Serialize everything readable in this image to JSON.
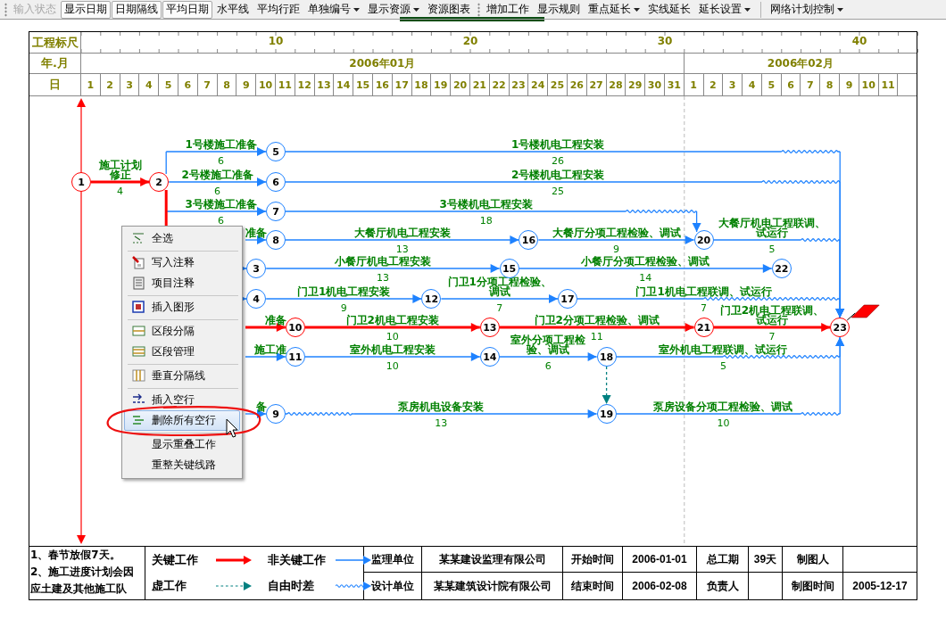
{
  "toolbar": {
    "groups": [
      {
        "kind": "grip",
        "items": [
          {
            "label": "输入状态",
            "disabled": true,
            "pressed": false,
            "dropdown": false
          },
          {
            "label": "显示日期",
            "disabled": false,
            "pressed": true,
            "dropdown": false
          },
          {
            "label": "日期隔线",
            "disabled": false,
            "pressed": true,
            "dropdown": false
          },
          {
            "label": "平均日期",
            "disabled": false,
            "pressed": true,
            "dropdown": false
          },
          {
            "label": "水平线",
            "disabled": false,
            "pressed": false,
            "dropdown": false
          },
          {
            "label": "平均行距",
            "disabled": false,
            "pressed": false,
            "dropdown": false
          },
          {
            "label": "单独编号",
            "disabled": false,
            "pressed": false,
            "dropdown": true
          },
          {
            "label": "显示资源",
            "disabled": false,
            "pressed": false,
            "dropdown": true
          },
          {
            "label": "资源图表",
            "disabled": false,
            "pressed": false,
            "dropdown": false
          }
        ]
      },
      {
        "kind": "grip",
        "items": [
          {
            "label": "增加工作",
            "disabled": false,
            "pressed": false,
            "dropdown": false
          },
          {
            "label": "显示规则",
            "disabled": false,
            "pressed": false,
            "dropdown": false
          },
          {
            "label": "重点延长",
            "disabled": false,
            "pressed": false,
            "dropdown": true
          },
          {
            "label": "实线延长",
            "disabled": false,
            "pressed": false,
            "dropdown": false
          },
          {
            "label": "延长设置",
            "disabled": false,
            "pressed": false,
            "dropdown": true
          }
        ]
      },
      {
        "kind": "line",
        "items": [
          {
            "label": "网络计划控制",
            "disabled": false,
            "pressed": false,
            "dropdown": true
          }
        ]
      }
    ]
  },
  "header": {
    "scale_title": "工程标尺",
    "scale_labels": [
      "10",
      "20",
      "30",
      "40"
    ],
    "month_title": "年.月",
    "day_title": "日",
    "months": [
      {
        "label": "2006年01月",
        "days": [
          "1",
          "2",
          "3",
          "4",
          "5",
          "6",
          "7",
          "8",
          "9",
          "10",
          "11",
          "12",
          "13",
          "14",
          "15",
          "16",
          "17",
          "18",
          "19",
          "20",
          "21",
          "22",
          "23",
          "24",
          "25",
          "26",
          "27",
          "28",
          "29",
          "30",
          "31"
        ]
      },
      {
        "label": "2006年02月",
        "days": [
          "1",
          "2",
          "3",
          "4",
          "5",
          "6",
          "7",
          "8",
          "9",
          "10",
          "11"
        ]
      }
    ]
  },
  "nodes": [
    {
      "label": "1",
      "critical": true
    },
    {
      "label": "2",
      "critical": true
    },
    {
      "label": "3",
      "critical": false
    },
    {
      "label": "4",
      "critical": false
    },
    {
      "label": "5",
      "critical": false
    },
    {
      "label": "6",
      "critical": false
    },
    {
      "label": "7",
      "critical": false
    },
    {
      "label": "8",
      "critical": false
    },
    {
      "label": "9",
      "critical": false
    },
    {
      "label": "10",
      "critical": true
    },
    {
      "label": "11",
      "critical": false
    },
    {
      "label": "12",
      "critical": false
    },
    {
      "label": "13",
      "critical": true
    },
    {
      "label": "14",
      "critical": false
    },
    {
      "label": "15",
      "critical": false
    },
    {
      "label": "16",
      "critical": false
    },
    {
      "label": "17",
      "critical": false
    },
    {
      "label": "18",
      "critical": false
    },
    {
      "label": "19",
      "critical": false
    },
    {
      "label": "20",
      "critical": false
    },
    {
      "label": "21",
      "critical": true
    },
    {
      "label": "22",
      "critical": false
    },
    {
      "label": "23",
      "critical": true
    }
  ],
  "edges": [
    {
      "label": "施工计划修正",
      "duration": "4",
      "kind": "critical"
    },
    {
      "label": "1号楼施工准备",
      "duration": "6",
      "kind": "normal"
    },
    {
      "label": "2号楼施工准备",
      "duration": "6",
      "kind": "normal"
    },
    {
      "label": "3号楼施工准备",
      "duration": "6",
      "kind": "normal"
    },
    {
      "label": "准备",
      "kind": "normal"
    },
    {
      "kind": "normal"
    },
    {
      "kind": "normal"
    },
    {
      "label": "准备",
      "kind": "critical"
    },
    {
      "label": "施工准",
      "kind": "normal"
    },
    {
      "label": "备",
      "kind": "normal"
    },
    {
      "label": "1号楼机电工程安装",
      "duration": "26",
      "kind": "normal",
      "free_float": true
    },
    {
      "label": "2号楼机电工程安装",
      "duration": "25",
      "kind": "normal",
      "free_float": true
    },
    {
      "label": "3号楼机电工程安装",
      "duration": "18",
      "kind": "normal",
      "free_float": true
    },
    {
      "label": "大餐厅机电工程安装",
      "duration": "13",
      "kind": "normal"
    },
    {
      "label": "大餐厅分项工程检验、调试",
      "duration": "9",
      "kind": "normal"
    },
    {
      "label": "大餐厅机电工程联调、试运行",
      "duration": "5",
      "kind": "normal",
      "free_float": true
    },
    {
      "label": "小餐厅机电工程安装",
      "duration": "13",
      "kind": "normal"
    },
    {
      "label": "小餐厅分项工程检验、调试",
      "duration": "14",
      "kind": "normal"
    },
    {
      "label": "门卫1机电工程安装",
      "duration": "9",
      "kind": "normal"
    },
    {
      "label": "门卫1分项工程检验、调试",
      "duration": "7",
      "kind": "normal"
    },
    {
      "label": "门卫1机电工程联调、试运行",
      "duration": "7",
      "kind": "normal",
      "free_float": true
    },
    {
      "label": "门卫2机电工程安装",
      "duration": "10",
      "kind": "critical"
    },
    {
      "label": "门卫2分项工程检验、调试",
      "duration": "11",
      "kind": "critical"
    },
    {
      "label": "门卫2机电工程联调、试运行",
      "duration": "7",
      "kind": "critical"
    },
    {
      "label": "室外机电工程安装",
      "duration": "10",
      "kind": "normal"
    },
    {
      "label": "室外分项工程检验、调试",
      "duration": "6",
      "kind": "normal"
    },
    {
      "label": "室外机电工程联调、试运行",
      "duration": "5",
      "kind": "normal",
      "free_float": true
    },
    {
      "kind": "dummy"
    },
    {
      "label": "泵房机电设备安装",
      "duration": "13",
      "kind": "normal",
      "free_float": true
    },
    {
      "label": "泵房设备分项工程检验、调试",
      "duration": "10",
      "kind": "normal",
      "free_float": true
    }
  ],
  "menu": {
    "items": [
      {
        "kind": "item",
        "label": "全选",
        "selected": false
      },
      {
        "kind": "separator"
      },
      {
        "kind": "item",
        "label": "写入注释",
        "selected": false
      },
      {
        "kind": "item",
        "label": "项目注释",
        "selected": false
      },
      {
        "kind": "separator"
      },
      {
        "kind": "item",
        "label": "插入图形",
        "selected": false
      },
      {
        "kind": "separator"
      },
      {
        "kind": "item",
        "label": "区段分隔",
        "selected": false
      },
      {
        "kind": "item",
        "label": "区段管理",
        "selected": false
      },
      {
        "kind": "separator"
      },
      {
        "kind": "item",
        "label": "垂直分隔线",
        "selected": false
      },
      {
        "kind": "separator"
      },
      {
        "kind": "item",
        "label": "插入空行",
        "selected": false
      },
      {
        "kind": "item",
        "label": "删除所有空行",
        "selected": true
      },
      {
        "kind": "separator"
      },
      {
        "kind": "item",
        "label": "显示重叠工作",
        "selected": false
      },
      {
        "kind": "item",
        "label": "重整关键线路",
        "selected": false
      }
    ]
  },
  "legend": {
    "notes": [
      "1、春节放假7天。",
      "2、施工进度计划会因应土建及其他施工队"
    ],
    "keys": [
      {
        "label": "关键工作",
        "kind": "critical"
      },
      {
        "label": "非关键工作",
        "kind": "normal"
      },
      {
        "label": "虚工作",
        "kind": "dummy"
      },
      {
        "label": "自由时差",
        "kind": "float"
      }
    ],
    "info": [
      [
        {
          "label": "监理单位",
          "value": "某某建设监理有限公司"
        },
        {
          "label": "开始时间",
          "value": "2006-01-01"
        },
        {
          "label": "总工期",
          "value": "39天"
        },
        {
          "label": "制图人"
        }
      ],
      [
        {
          "label": "设计单位",
          "value": "某某建筑设计院有限公司"
        },
        {
          "label": "结束时间",
          "value": "2006-02-08"
        },
        {
          "label": "负责人"
        },
        {
          "label": "制图时间",
          "value": "2005-12-17"
        }
      ]
    ]
  }
}
